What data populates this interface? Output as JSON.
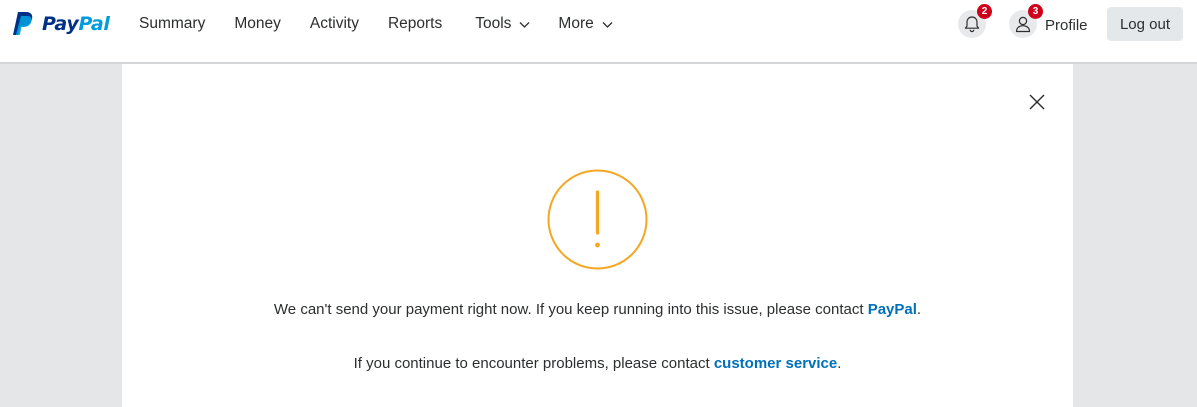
{
  "brand": {
    "name_part1": "Pay",
    "name_part2": "Pal",
    "logo_icon": "paypal-logo-icon",
    "colors": {
      "dark_blue": "#003087",
      "light_blue": "#009cde"
    }
  },
  "nav": {
    "items": [
      {
        "label": "Summary"
      },
      {
        "label": "Money"
      },
      {
        "label": "Activity"
      },
      {
        "label": "Reports"
      },
      {
        "label": "Tools"
      },
      {
        "label": "More"
      }
    ]
  },
  "header_actions": {
    "notifications": {
      "icon": "bell-icon",
      "count": "2"
    },
    "profile": {
      "icon": "user-icon",
      "count": "3",
      "label": "Profile"
    },
    "logout_label": "Log out"
  },
  "alert": {
    "icon": "exclamation-circle-icon",
    "accent_color": "#f5a623",
    "message_main": "We can't send your payment right now. If you keep running into this issue, please contact ",
    "message_main_link": "PayPal",
    "message_main_end": ".",
    "message_secondary": "If you continue to encounter problems, please contact ",
    "message_secondary_link": "customer service",
    "message_secondary_end": ".",
    "link_color": "#0070ba"
  }
}
